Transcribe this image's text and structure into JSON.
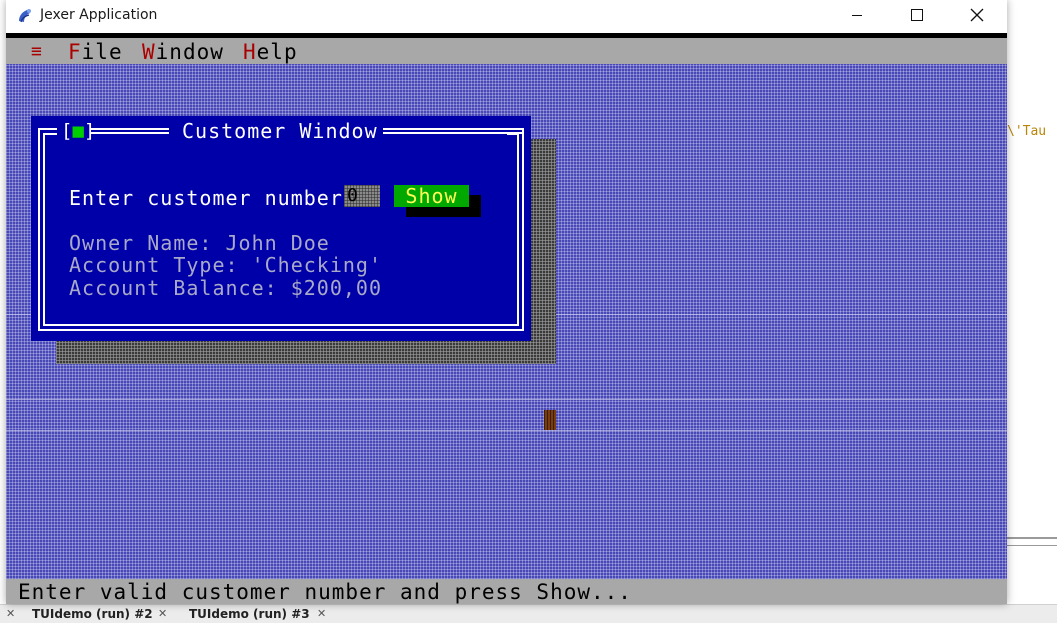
{
  "window": {
    "title": "Jexer Application"
  },
  "menubar": {
    "system_icon": "≡",
    "items": [
      {
        "hotkey": "F",
        "rest": "ile"
      },
      {
        "hotkey": "W",
        "rest": "indow"
      },
      {
        "hotkey": "H",
        "rest": "elp"
      }
    ]
  },
  "customer_window": {
    "close_box": "[",
    "close_dot": "■",
    "close_box_end": "]",
    "title": "Customer Window",
    "prompt_label": "Enter customer number:",
    "input_value": "0",
    "show_button": "Show",
    "owner_line": "Owner Name: John Doe",
    "type_line": "Account Type: 'Checking'",
    "balance_line": "Account Balance: $200,00"
  },
  "status": {
    "text": "Enter valid customer number and press Show..."
  },
  "background": {
    "ide_snippet": "\\'Tau",
    "tabs": [
      {
        "label": "TUIdemo (run) #2"
      },
      {
        "label": "TUIdemo (run) #3"
      }
    ]
  },
  "colors": {
    "desktop": "#4848b8",
    "window_bg": "#0000a8",
    "button": "#00a800",
    "button_text": "#ffff55",
    "hotkey": "#aa0000",
    "menubar": "#a8a8a8"
  },
  "icons": {
    "app": "jexer-app-icon",
    "minimize": "minimize-icon",
    "maximize": "maximize-icon",
    "close": "close-icon"
  }
}
